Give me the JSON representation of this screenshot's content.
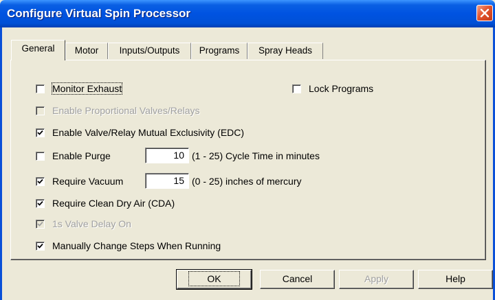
{
  "window": {
    "title": "Configure Virtual Spin Processor"
  },
  "tabs": [
    {
      "label": "General",
      "active": true
    },
    {
      "label": "Motor",
      "active": false
    },
    {
      "label": "Inputs/Outputs",
      "active": false
    },
    {
      "label": "Programs",
      "active": false
    },
    {
      "label": "Spray Heads",
      "active": false
    }
  ],
  "options": {
    "monitor_exhaust": {
      "label": "Monitor Exhaust",
      "checked": false,
      "enabled": true
    },
    "lock_programs": {
      "label": "Lock Programs",
      "checked": false,
      "enabled": true
    },
    "enable_proportional": {
      "label": "Enable Proportional Valves/Relays",
      "checked": false,
      "enabled": false
    },
    "mutual_exclusivity": {
      "label": "Enable Valve/Relay Mutual Exclusivity (EDC)",
      "checked": true,
      "enabled": true
    },
    "enable_purge": {
      "label": "Enable Purge",
      "checked": false,
      "enabled": true,
      "value": "10",
      "hint": "(1 - 25) Cycle Time in minutes"
    },
    "require_vacuum": {
      "label": "Require Vacuum",
      "checked": true,
      "enabled": true,
      "value": "15",
      "hint": "(0 - 25) inches of mercury"
    },
    "require_cda": {
      "label": "Require Clean Dry Air (CDA)",
      "checked": true,
      "enabled": true
    },
    "valve_delay": {
      "label": "1s Valve Delay On",
      "checked": true,
      "enabled": false
    },
    "manual_steps": {
      "label": "Manually Change Steps When Running",
      "checked": true,
      "enabled": true
    }
  },
  "buttons": {
    "ok": "OK",
    "cancel": "Cancel",
    "apply": "Apply",
    "help": "Help"
  },
  "icons": {
    "close": "close-icon",
    "checkmark": "checkmark-icon"
  },
  "colors": {
    "title_bar": "#0053e1",
    "close_button": "#e2542e",
    "dialog_bg": "#ece9d8"
  }
}
